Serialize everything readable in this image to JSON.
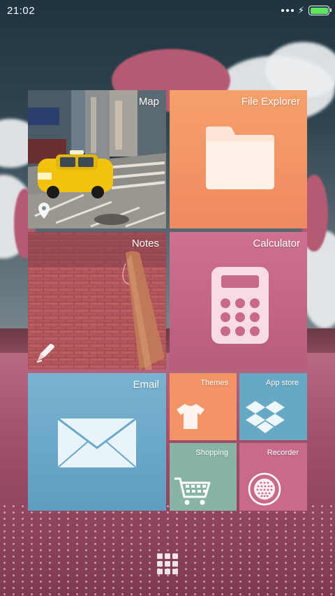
{
  "status_bar": {
    "time": "21:02",
    "signal_icon": "more-dots-icon",
    "charging_icon": "charging-bolt-icon",
    "battery_level": 1.0,
    "battery_color": "#5fe55f"
  },
  "tiles": {
    "map": {
      "label": "Map",
      "icon": "location-pin-icon"
    },
    "file_explorer": {
      "label": "File Explorer",
      "icon": "folder-icon"
    },
    "notes": {
      "label": "Notes",
      "icon": "pen-icon"
    },
    "calculator": {
      "label": "Calculator",
      "icon": "calculator-icon"
    },
    "email": {
      "label": "Email",
      "icon": "envelope-icon"
    },
    "themes": {
      "label": "Themes",
      "icon": "tshirt-icon"
    },
    "app_store": {
      "label": "App store",
      "icon": "dropbox-box-icon"
    },
    "shopping": {
      "label": "Shopping",
      "icon": "shopping-cart-icon"
    },
    "recorder": {
      "label": "Recorder",
      "icon": "microphone-grille-icon"
    }
  },
  "colors": {
    "file_explorer": "#f39466",
    "calculator": "#c86a8c",
    "email": "#6aa8cb",
    "themes": "#f39466",
    "app_store": "#67a9c4",
    "shopping": "#87b4a5",
    "recorder": "#c96a8b"
  },
  "dock": {
    "app_drawer_icon": "app-drawer-grid-icon"
  }
}
